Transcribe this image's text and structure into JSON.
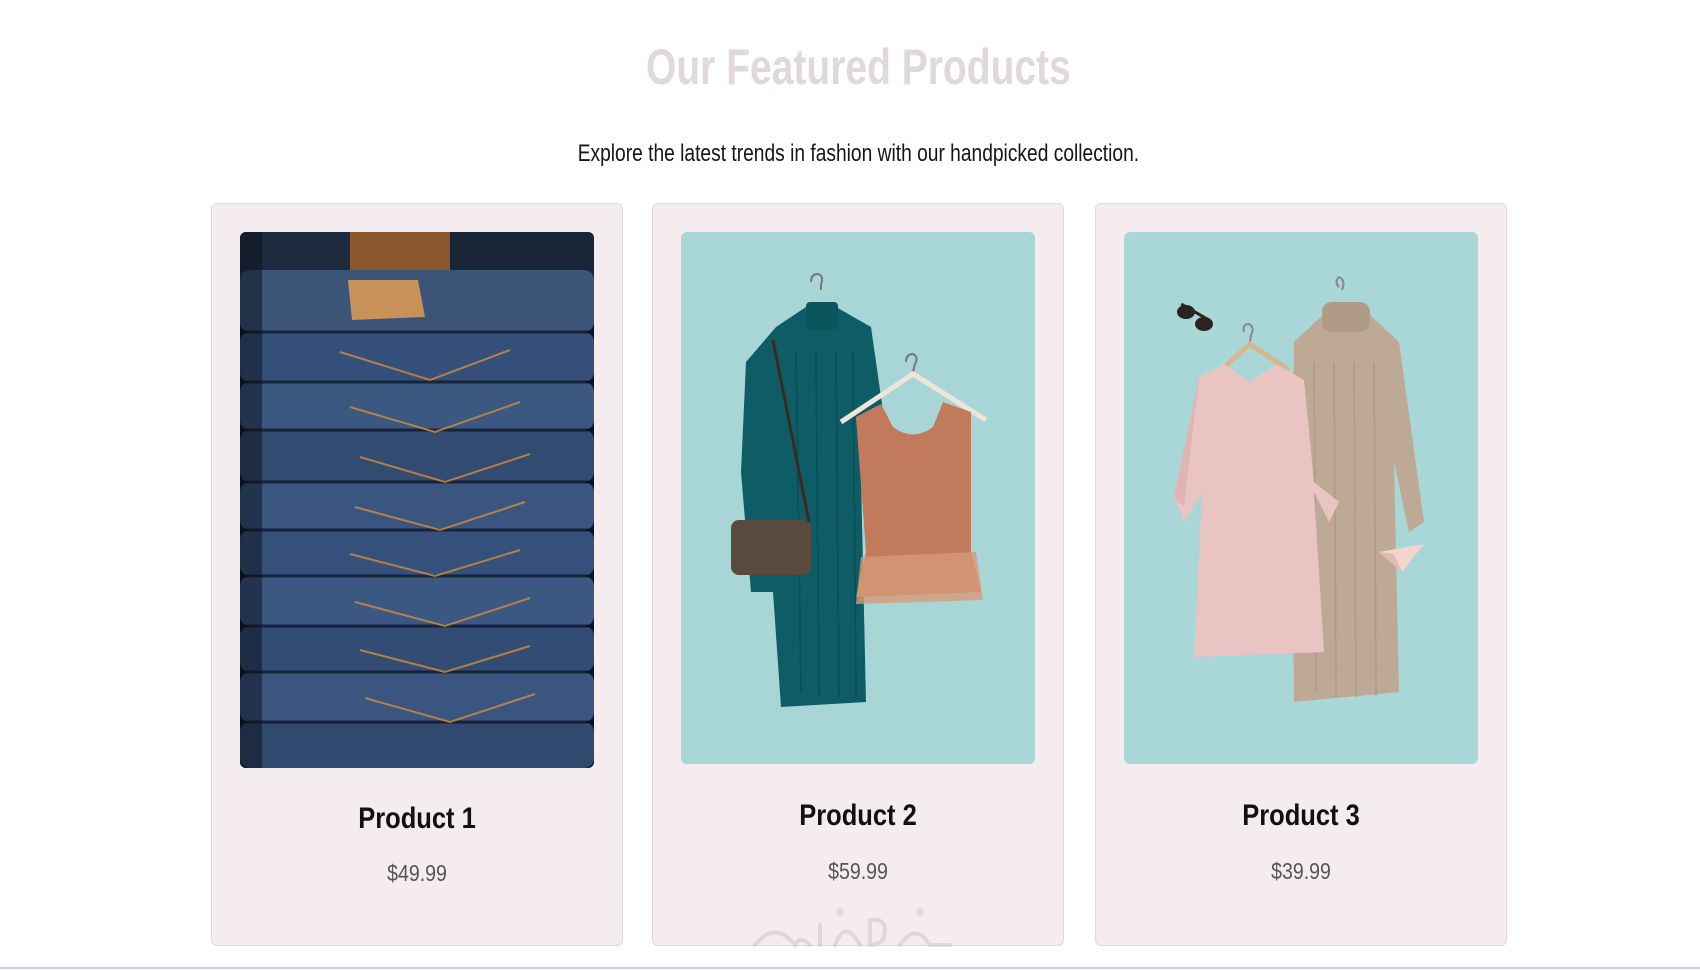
{
  "section": {
    "title": "Our Featured Products",
    "subtitle": "Explore the latest trends in fashion with our handpicked collection."
  },
  "products": [
    {
      "name": "Product 1",
      "price": "$49.99",
      "image": "stacked-denim-jeans"
    },
    {
      "name": "Product 2",
      "price": "$59.99",
      "image": "teal-sweater-dress-and-rust-top-on-hangers"
    },
    {
      "name": "Product 3",
      "price": "$39.99",
      "image": "pink-dress-and-beige-sweater-dress-on-hangers"
    }
  ],
  "colors": {
    "title": "#e1d8de",
    "card_bg": "#f4ecee",
    "card_border": "#e2d8dc",
    "photo_bg": "#a9d6d6"
  }
}
